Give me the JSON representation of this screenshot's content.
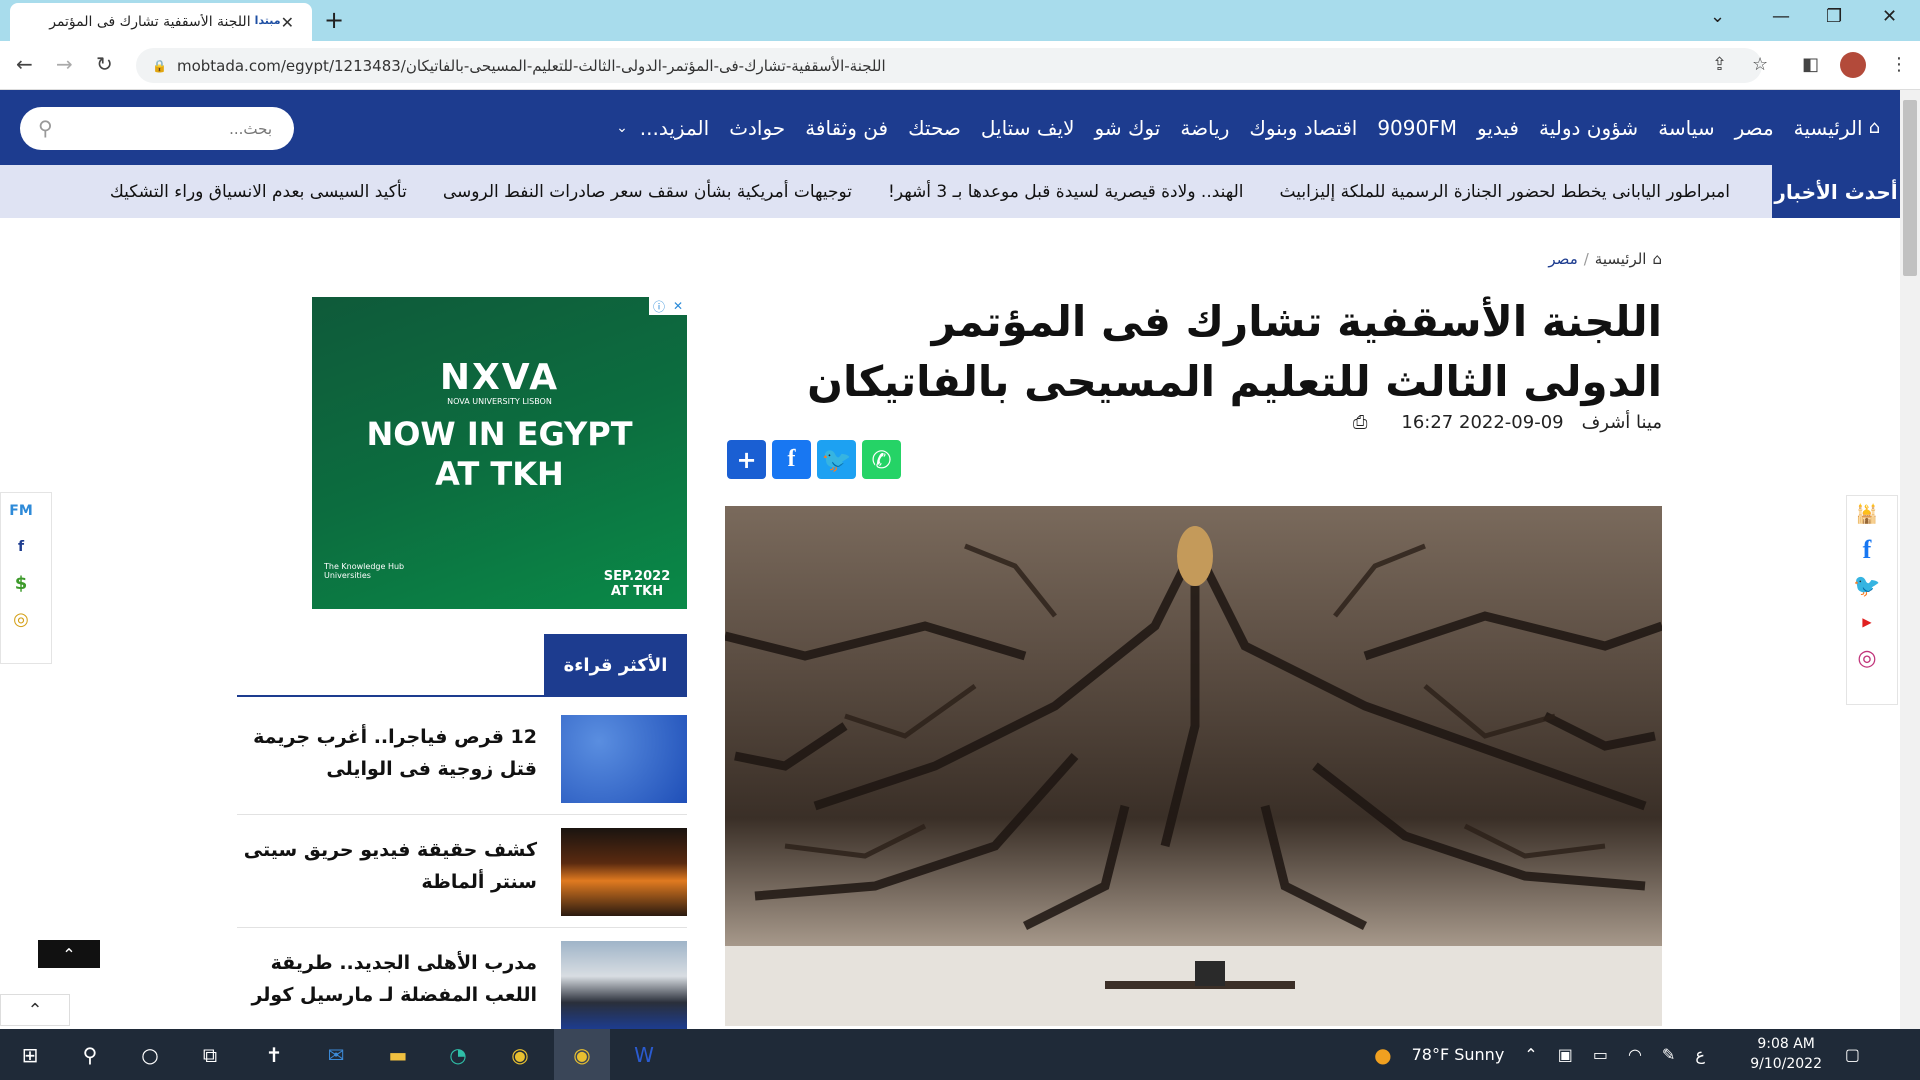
{
  "browser": {
    "tab_title": "اللجنة الأسقفية تشارك فى المؤتمر",
    "tab_favicon": "مبتدا",
    "url": "mobtada.com/egypt/1213483/اللجنة-الأسقفية-تشارك-فى-المؤتمر-الدولى-الثالث-للتعليم-المسيحى-بالفاتيكان"
  },
  "nav": {
    "search_placeholder": "بحث...",
    "items": [
      "الرئيسية",
      "مصر",
      "سياسة",
      "شؤون دولية",
      "فيديو",
      "9090FM",
      "اقتصاد وبنوك",
      "رياضة",
      "توك شو",
      "لايف ستايل",
      "صحتك",
      "فن وثقافة",
      "حوادث",
      "المزيد..."
    ]
  },
  "ticker": {
    "label": "أحدث الأخبار",
    "items": [
      "امبراطور اليابانى يخطط لحضور الجنازة الرسمية للملكة إليزابيث",
      "الهند.. ولادة قيصرية لسيدة قبل موعدها بـ 3 أشهر!",
      "توجيهات أمريكية بشأن سقف سعر صادرات النفط الروسى",
      "تأكيد السيسى بعدم الانسياق وراء التشكيك"
    ]
  },
  "breadcrumb": {
    "home": "الرئيسية",
    "current": "مصر"
  },
  "article": {
    "title": "اللجنة الأسقفية تشارك فى المؤتمر الدولى الثالث للتعليم المسيحى بالفاتيكان",
    "author": "مينا أشرف",
    "date": "2022-09-09 16:27"
  },
  "ad": {
    "brand": "NXVA",
    "brand_sub": "NOVA UNIVERSITY LISBON",
    "line1": "NOW IN EGYPT",
    "line2": "AT TKH",
    "date": "SEP.2022 AT TKH",
    "sponsor": "The Knowledge Hub Universities"
  },
  "most_read": {
    "label": "الأكثر قراءة",
    "items": [
      {
        "title": "12 قرص فياجرا.. أغرب جريمة قتل زوجية فى الوايلى"
      },
      {
        "title": "كشف حقيقة فيديو حريق سيتى سنتر ألماظة"
      },
      {
        "title": "مدرب الأهلى الجديد.. طريقة اللعب المفضلة لـ مارسيل كولر"
      }
    ]
  },
  "taskbar": {
    "weather": "78°F  Sunny",
    "lang": "ع",
    "time": "9:08 AM",
    "date": "9/10/2022"
  },
  "colors": {
    "brand": "#1d3c8f",
    "ticker_bg": "#dfe3f3"
  }
}
